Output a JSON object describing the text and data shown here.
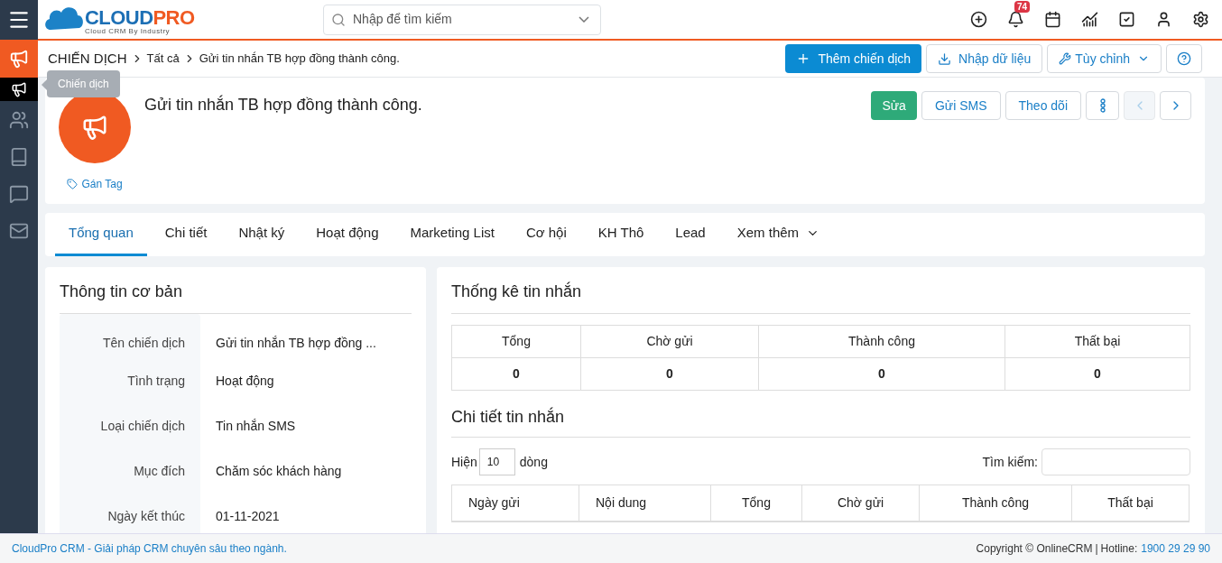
{
  "logo": {
    "brand_a": "CLOUD",
    "brand_b": "PRO",
    "tagline": "Cloud CRM By Industry"
  },
  "search": {
    "placeholder": "Nhập để tìm kiếm"
  },
  "notifications_badge": "74",
  "sidebar": {
    "items": [
      {
        "selected": true,
        "hovered": false
      },
      {
        "selected": false,
        "hovered": true
      },
      {
        "selected": false,
        "hovered": false
      },
      {
        "selected": false,
        "hovered": false
      },
      {
        "selected": false,
        "hovered": false
      },
      {
        "selected": false,
        "hovered": false
      }
    ],
    "tooltip": "Chiến dịch"
  },
  "breadcrumb": [
    "CHIẾN DỊCH",
    "Tất cả",
    "Gửi tin nhắn TB hợp đồng thành công."
  ],
  "toolbar_buttons": [
    {
      "kind": "primary",
      "label": "Thêm chiến dịch"
    },
    {
      "kind": "import",
      "label": "Nhập dữ liệu"
    },
    {
      "kind": "dropdown",
      "label": "Tùy chỉnh"
    },
    {
      "kind": "help"
    }
  ],
  "record": {
    "title": "Gửi tin nhắn TB hợp đồng thành công.",
    "tag_link": "Gán Tag",
    "actions": [
      {
        "kind": "success",
        "label": "Sửa",
        "disabled": false
      },
      {
        "kind": "outline",
        "label": "Gửi SMS",
        "disabled": false
      },
      {
        "kind": "outline",
        "label": "Theo dõi",
        "disabled": false
      },
      {
        "kind": "more",
        "disabled": false
      },
      {
        "kind": "prev",
        "disabled": true
      },
      {
        "kind": "next",
        "disabled": false
      }
    ]
  },
  "tabs": [
    {
      "label": "Tổng quan",
      "selected": true,
      "kind": "tab"
    },
    {
      "label": "Chi tiết",
      "selected": false,
      "kind": "tab"
    },
    {
      "label": "Nhật ký",
      "selected": false,
      "kind": "tab"
    },
    {
      "label": "Hoạt động",
      "selected": false,
      "kind": "tab"
    },
    {
      "label": "Marketing List",
      "selected": false,
      "kind": "tab"
    },
    {
      "label": "Cơ hội",
      "selected": false,
      "kind": "tab"
    },
    {
      "label": "KH Thô",
      "selected": false,
      "kind": "tab"
    },
    {
      "label": "Lead",
      "selected": false,
      "kind": "tab"
    },
    {
      "label": "Xem thêm",
      "selected": false,
      "kind": "more"
    }
  ],
  "basic_info": {
    "title": "Thông tin cơ bản",
    "fields": [
      {
        "label": "Tên chiến dịch",
        "value": "Gửi tin nhắn TB hợp đồng ..."
      },
      {
        "label": "Tình trạng",
        "value": "Hoạt động"
      },
      {
        "label": "Loại chiến dịch",
        "value": "Tin nhắn SMS"
      },
      {
        "label": "Mục đích",
        "value": "Chăm sóc khách hàng"
      },
      {
        "label": "Ngày kết thúc",
        "value": "01-11-2021"
      }
    ]
  },
  "stats": {
    "title": "Thống kê tin nhắn",
    "columns": [
      "Tổng",
      "Chờ gửi",
      "Thành công",
      "Thất bại"
    ],
    "values": [
      "0",
      "0",
      "0",
      "0"
    ]
  },
  "details": {
    "title": "Chi tiết tin nhắn",
    "show_label": "Hiện",
    "page_size": "10",
    "rows_label": "dòng",
    "search_label": "Tìm kiếm:",
    "columns": [
      "Ngày gửi",
      "Nội dung",
      "Tổng",
      "Chờ gửi",
      "Thành công",
      "Thất bại"
    ]
  },
  "footer": {
    "left": "CloudPro CRM - Giải pháp CRM chuyên sâu theo ngành.",
    "copyright": "Copyright © OnlineCRM",
    "separator": "|",
    "hotline_label": "Hotline:",
    "hotline": "1900 29 29 90"
  }
}
